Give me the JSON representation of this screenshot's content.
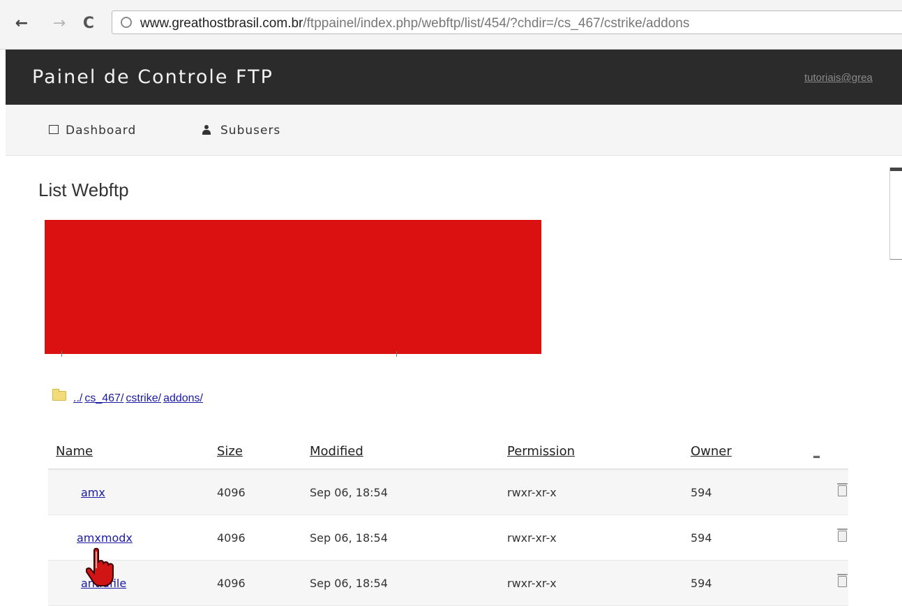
{
  "browser": {
    "url_host": "www.greathostbrasil.com.br",
    "url_path": "/ftppainel/index.php/webftp/list/454/?chdir=/cs_467/cstrike/addons"
  },
  "header": {
    "brand": "Painel de Controle FTP",
    "user_link": "tutoriais@grea"
  },
  "subnav": {
    "dashboard": "Dashboard",
    "subusers": "Subusers"
  },
  "page": {
    "title": "List Webftp"
  },
  "breadcrumb": [
    "../",
    "cs_467/",
    "cstrike/",
    "addons/"
  ],
  "table": {
    "headers": {
      "name": "Name",
      "size": "Size",
      "modified": "Modified",
      "permission": "Permission",
      "owner": "Owner",
      "action": "_"
    },
    "rows": [
      {
        "name": "amx",
        "size": "4096",
        "modified": "Sep 06, 18:54",
        "permission": "rwxr-xr-x",
        "owner": "594",
        "action_icon": "trash-icon"
      },
      {
        "name": "amxmodx",
        "size": "4096",
        "modified": "Sep 06, 18:54",
        "permission": "rwxr-xr-x",
        "owner": "594",
        "action_icon": "trash-icon"
      },
      {
        "name": "antidfile",
        "size": "4096",
        "modified": "Sep 06, 18:54",
        "permission": "rwxr-xr-x",
        "owner": "594",
        "action_icon": "trash-icon"
      }
    ]
  },
  "colors": {
    "topbar": "#2b2b2b",
    "redaction": "#db1010",
    "link": "#1a1aa6"
  }
}
